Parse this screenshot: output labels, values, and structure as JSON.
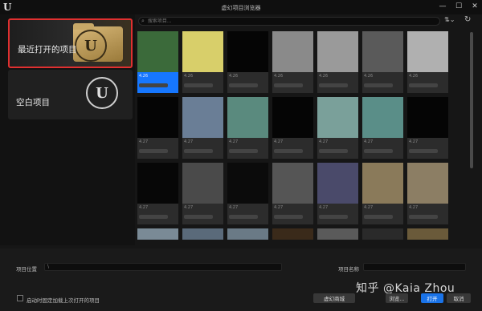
{
  "window": {
    "title": "虚幻项目浏览器",
    "logo": "U",
    "min": "—",
    "max": "☐",
    "close": "✕"
  },
  "categories": [
    {
      "label": "最近打开的项目"
    },
    {
      "label": "空白项目"
    }
  ],
  "search": {
    "placeholder": "搜索项目..."
  },
  "tiles": [
    {
      "ver": "4.26",
      "thumb": "#3b6a3a",
      "sel": true
    },
    {
      "ver": "4.26",
      "thumb": "#d8cf6a"
    },
    {
      "ver": "4.26",
      "thumb": "#050505"
    },
    {
      "ver": "4.26",
      "thumb": "#8a8a8a"
    },
    {
      "ver": "4.26",
      "thumb": "#9a9a9a"
    },
    {
      "ver": "4.26",
      "thumb": "#5a5a5a"
    },
    {
      "ver": "4.26",
      "thumb": "#b0b0b0"
    },
    {
      "ver": "4.27",
      "thumb": "#050505"
    },
    {
      "ver": "4.27",
      "thumb": "#6a7e96"
    },
    {
      "ver": "4.27",
      "thumb": "#5a8a7e"
    },
    {
      "ver": "4.27",
      "thumb": "#050505"
    },
    {
      "ver": "4.27",
      "thumb": "#7aa09a"
    },
    {
      "ver": "4.27",
      "thumb": "#5a8e88"
    },
    {
      "ver": "4.27",
      "thumb": "#050505"
    },
    {
      "ver": "4.27",
      "thumb": "#070707"
    },
    {
      "ver": "4.27",
      "thumb": "#4a4a4a"
    },
    {
      "ver": "4.27",
      "thumb": "#0b0b0b"
    },
    {
      "ver": "4.27",
      "thumb": "#555555"
    },
    {
      "ver": "4.27",
      "thumb": "#4a4a6a"
    },
    {
      "ver": "4.27",
      "thumb": "#8a7a5a"
    },
    {
      "ver": "4.27",
      "thumb": "#8c7e64"
    },
    {
      "ver": "",
      "thumb": "#7a8a96"
    },
    {
      "ver": "",
      "thumb": "#5a6a7a"
    },
    {
      "ver": "",
      "thumb": "#6a7a86"
    },
    {
      "ver": "",
      "thumb": "#3a2a1a"
    },
    {
      "ver": "",
      "thumb": "#5a5a5a"
    },
    {
      "ver": "",
      "thumb": "#2a2a2a"
    },
    {
      "ver": "",
      "thumb": "#6a5a3a"
    }
  ],
  "bottom": {
    "project_location_label": "项目位置",
    "project_location_value": "\\",
    "project_name_label": "项目名称",
    "checkbox_label": "启动时固定加载上次打开的项目",
    "marketplace_btn": "虚幻商城",
    "browse_btn": "浏览...",
    "open_btn": "打开",
    "cancel_btn": "取消"
  },
  "watermark": "知乎 @Kaia Zhou",
  "colors": {
    "accent": "#1a73e8",
    "highlight_border": "#e03030"
  }
}
